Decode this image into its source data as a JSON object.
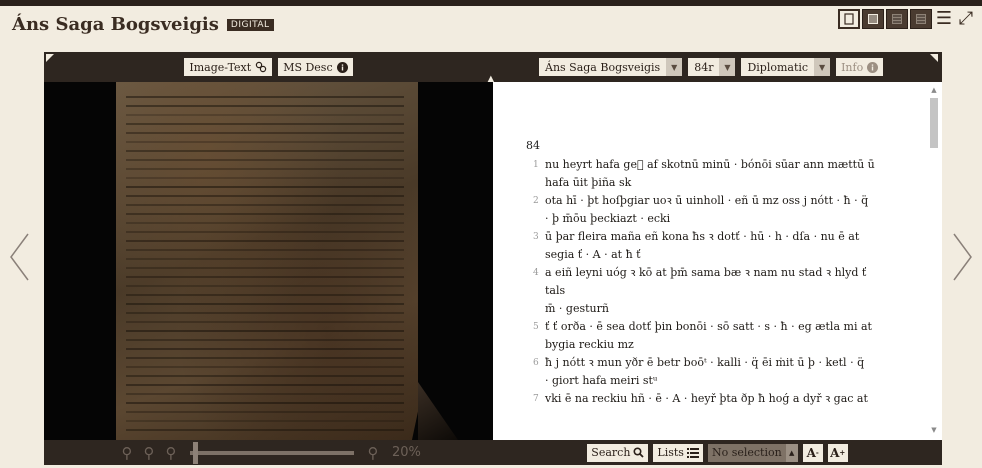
{
  "header": {
    "title": "Áns Saga Bogsveigis",
    "badge": "DIGITAL"
  },
  "view_modes": [
    {
      "name": "single-pane-view",
      "icon": "single-page-icon"
    },
    {
      "name": "text-view",
      "icon": "text-page-icon"
    },
    {
      "name": "split-view",
      "icon": "split-page-icon"
    },
    {
      "name": "dual-text-view",
      "icon": "dual-page-icon"
    }
  ],
  "image_toolbar": {
    "image_text_label": "Image-Text",
    "ms_desc_label": "MS Desc"
  },
  "text_toolbar": {
    "text_select": "Áns Saga Bogsveigis",
    "page_select": "84r",
    "level_select": "Diplomatic",
    "info_label": "Info"
  },
  "text_pane": {
    "page_number": "84",
    "lines": [
      {
        "num": "1",
        "text": "nu heyrt hafa geᷣ af skotnū minū · bónōi sūar ann mættū ū",
        "cont": "hafa ūit þiña sk"
      },
      {
        "num": "2",
        "text": "ota hī · þt hoſþgiar uoꝛ ū uinholl · eñ ū mz oss j nótt · ħ · q̈",
        "cont": "· þ m̄ōu þeckiazt · ecki"
      },
      {
        "num": "3",
        "text": "ū þar fleira maña eñ kona ħs ꝛ dotť · hū · h · dſa · nu ē at",
        "cont": "segia ť · A · at ħ ť"
      },
      {
        "num": "4",
        "text": "a eiñ leyni uóg ꝛ kō at þm̄ sama bæ ꝛ nam nu stad ꝛ hlyd ť tals",
        "cont": "m̄ · gesturñ"
      },
      {
        "num": "5",
        "text": "ť ť orða · ē sea dotť þin bonōi · sō satt · s · ħ · eg ætla mi at",
        "cont": "bygia reckiu mz"
      },
      {
        "num": "6",
        "text": "ħ j nótt ꝛ mun yðr ē betr boōᵗ · kalli · q̈ ēi ṁit ū þ · ketl · q̈",
        "cont": "· giort hafa meiri stᵘ"
      },
      {
        "num": "7",
        "text": "vki ē na reckiu hñ · ē · A · heyř þta ðp ħ hoǵ a dyř ꝛ gac at",
        "cont": ""
      }
    ]
  },
  "zoom": {
    "percent": "20%",
    "level": 0.02
  },
  "text_bottom": {
    "search_label": "Search",
    "lists_label": "Lists",
    "selection_label": "No selection",
    "font_decrease": "A",
    "font_increase": "A"
  },
  "colors": {
    "background": "#f2ece0",
    "frame": "#2e2620",
    "accent_dark": "#3a2c22"
  }
}
